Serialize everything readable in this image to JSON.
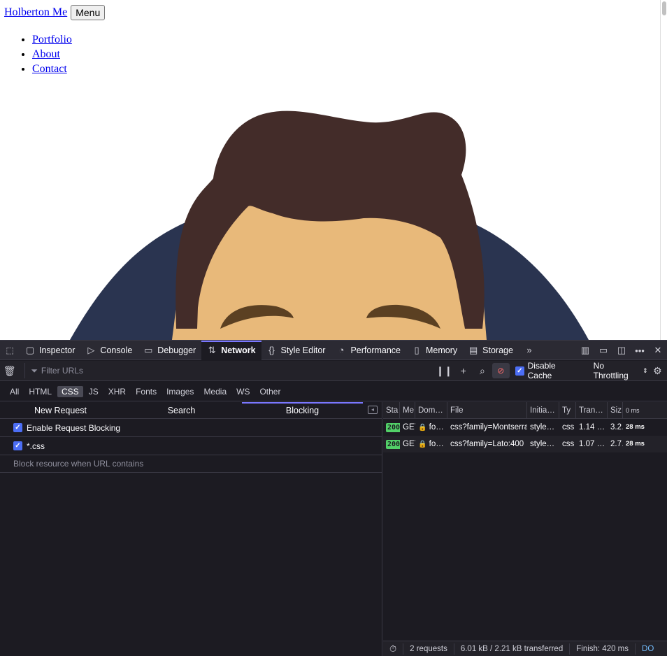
{
  "page": {
    "site_title": "Holberton Me",
    "menu_button": "Menu",
    "nav": [
      "Portfolio",
      "About",
      "Contact"
    ]
  },
  "devtools": {
    "tabs": [
      {
        "label": "Inspector",
        "icon": "inspector-icon"
      },
      {
        "label": "Console",
        "icon": "console-icon"
      },
      {
        "label": "Debugger",
        "icon": "debugger-icon"
      },
      {
        "label": "Network",
        "icon": "network-icon",
        "active": true
      },
      {
        "label": "Style Editor",
        "icon": "style-editor-icon"
      },
      {
        "label": "Performance",
        "icon": "performance-icon"
      },
      {
        "label": "Memory",
        "icon": "memory-icon"
      },
      {
        "label": "Storage",
        "icon": "storage-icon"
      }
    ],
    "filter_placeholder": "Filter URLs",
    "disable_cache_label": "Disable Cache",
    "throttling": "No Throttling",
    "type_filters": [
      "All",
      "HTML",
      "CSS",
      "JS",
      "XHR",
      "Fonts",
      "Images",
      "Media",
      "WS",
      "Other"
    ],
    "active_type": "CSS",
    "side_tabs": [
      "New Request",
      "Search",
      "Blocking"
    ],
    "active_side_tab": "Blocking",
    "blocking": {
      "enable_label": "Enable Request Blocking",
      "patterns": [
        "*.css"
      ],
      "input_placeholder": "Block resource when URL contains"
    },
    "columns": [
      "Sta",
      "Me",
      "Dom…",
      "File",
      "Initia…",
      "Ty",
      "Tran…",
      "Siz",
      "0 ms"
    ],
    "requests": [
      {
        "status": "200",
        "method": "GET",
        "domain": "fo…",
        "file": "css?family=Montserrat",
        "initiator": "style…",
        "type": "css",
        "transferred": "1.14 …",
        "size": "3.2…",
        "time": "28 ms"
      },
      {
        "status": "200",
        "method": "GET",
        "domain": "fo…",
        "file": "css?family=Lato:400",
        "initiator": "style…",
        "type": "css",
        "transferred": "1.07 …",
        "size": "2.7…",
        "time": "28 ms"
      }
    ],
    "footer": {
      "requests": "2 requests",
      "transferred": "6.01 kB / 2.21 kB transferred",
      "finish": "Finish: 420 ms",
      "dom": "DO"
    }
  },
  "colors": {
    "accent": "#7a77ff",
    "status_ok": "#52d068",
    "hair": "#432c29",
    "skin": "#e8b97a",
    "shirt": "#2a3450"
  }
}
